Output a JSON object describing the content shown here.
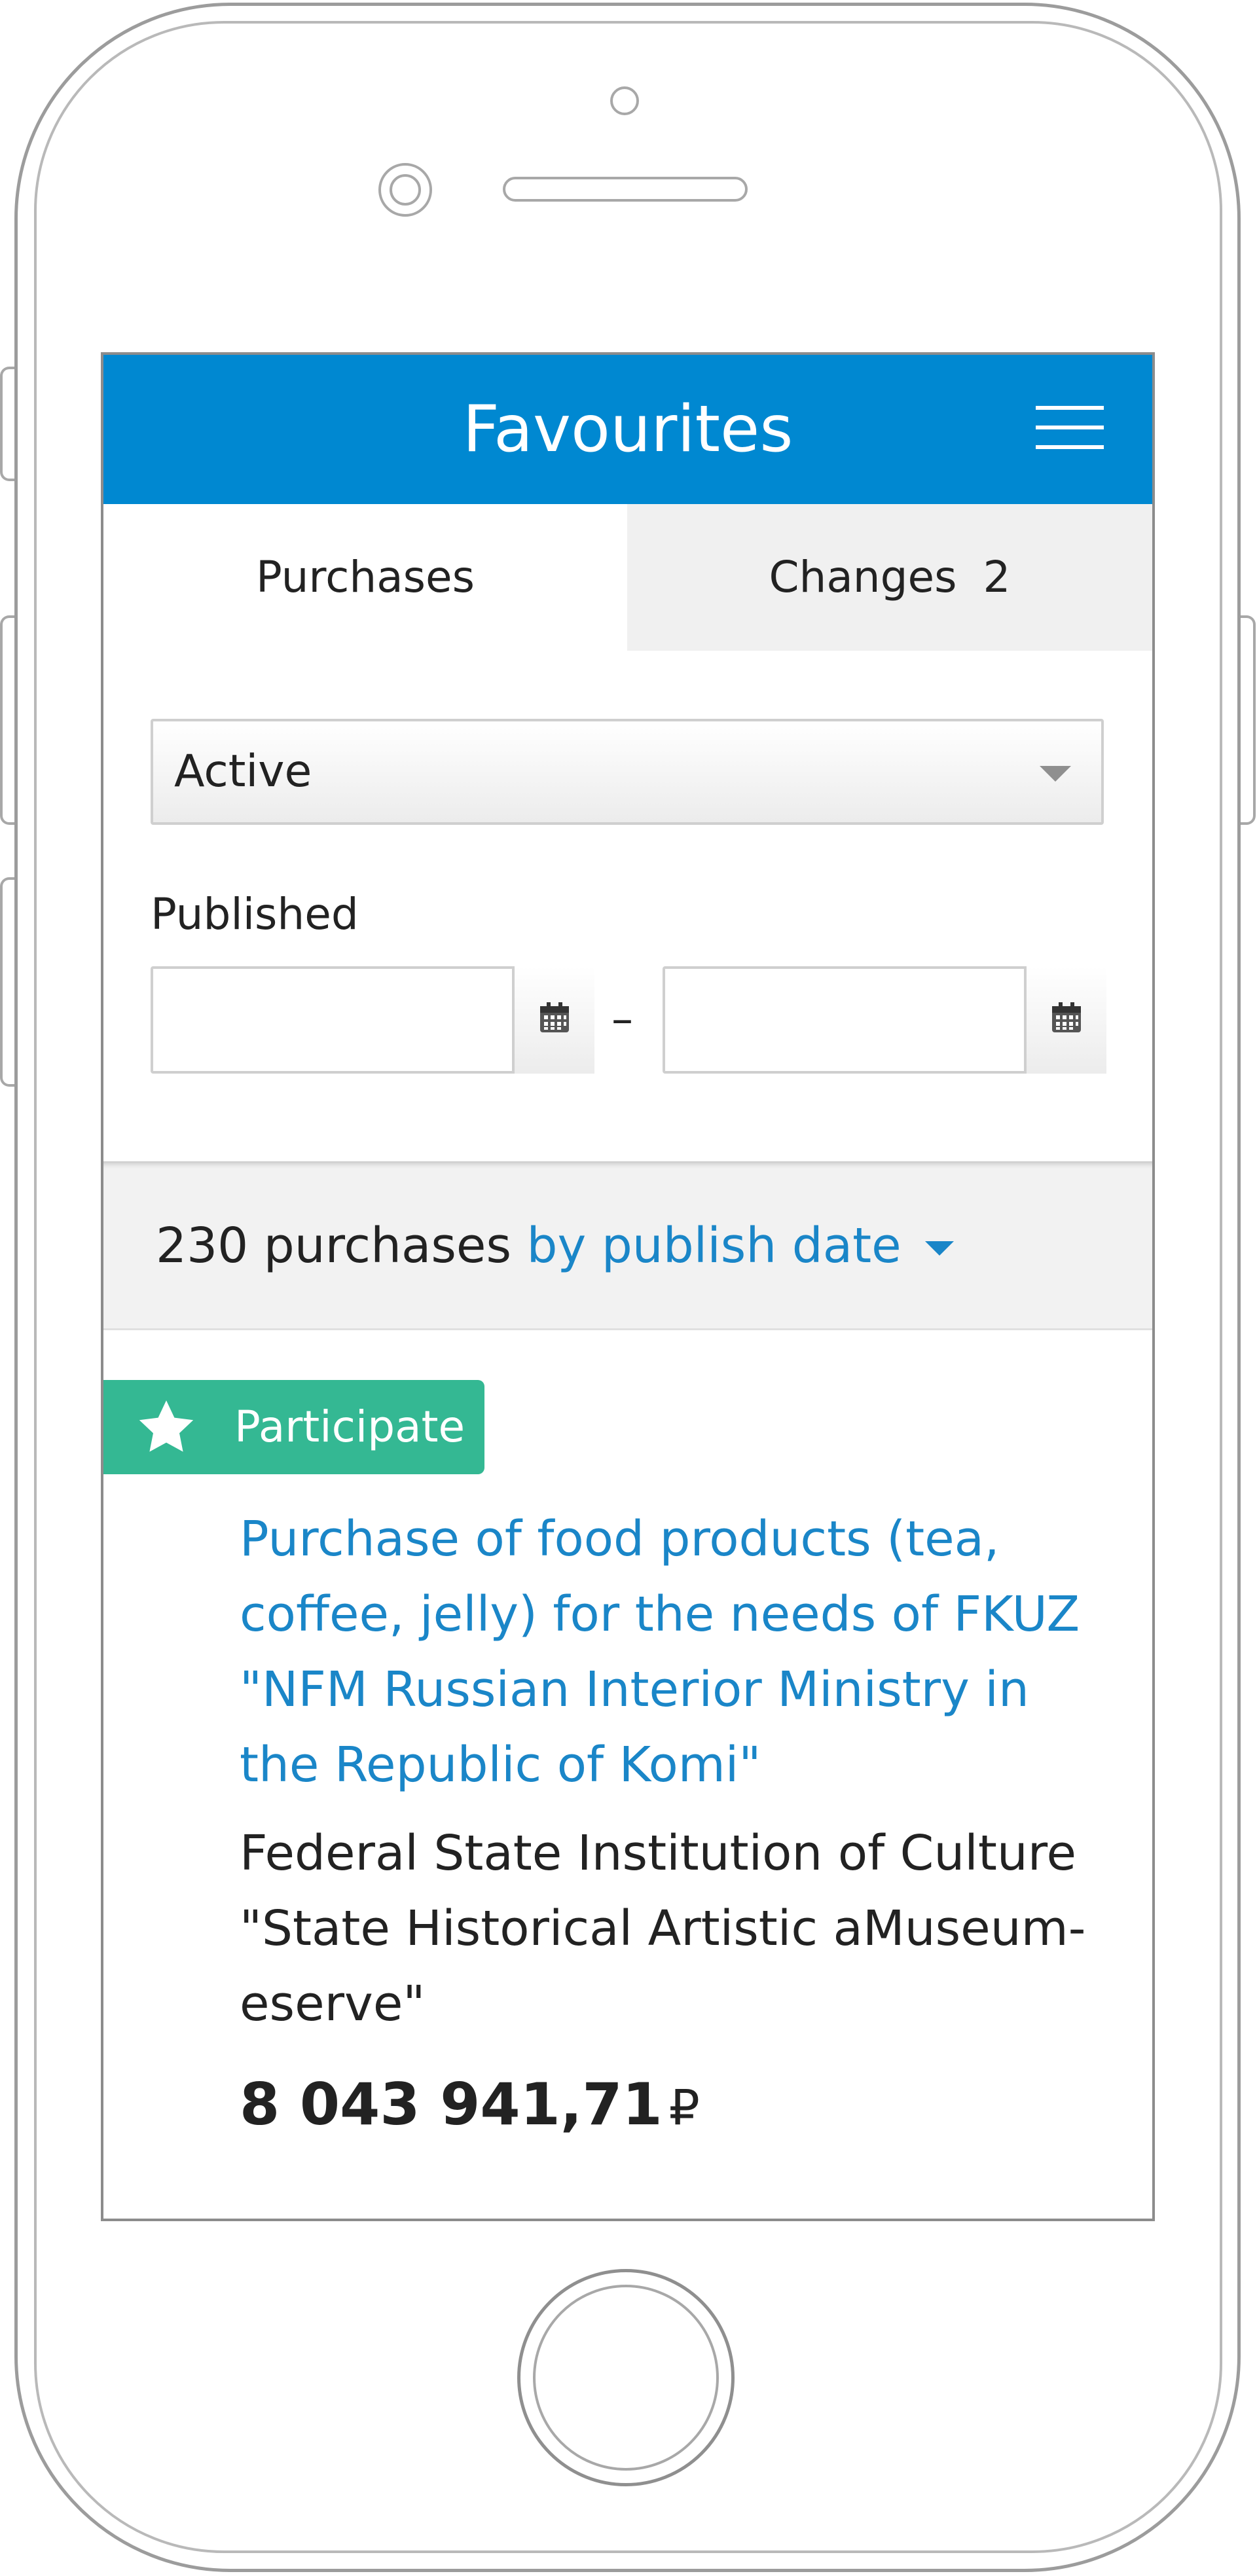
{
  "header": {
    "title": "Favourites",
    "menu_icon": "hamburger-menu-icon"
  },
  "tabs": [
    {
      "label": "Purchases",
      "active": true
    },
    {
      "label": "Changes",
      "count": "2",
      "active": false
    }
  ],
  "filters": {
    "status": {
      "value": "Active"
    },
    "published": {
      "label": "Published",
      "from_value": "",
      "to_value": "",
      "separator": "–"
    }
  },
  "results": {
    "count_text": "230 purchases",
    "sort_label": "by publish date"
  },
  "purchase": {
    "badge_label": "Participate",
    "title": "Purchase of food products (tea, coffee, jelly) for the needs of FKUZ \"NFM Russian Interior Ministry in the Republic of Komi\"",
    "organization": "Federal State Institution of Culture \"State Historical Artistic aMuseum-eserve\"",
    "price": "8 043 941,71",
    "currency": "₽"
  },
  "colors": {
    "header_bg": "#0088d1",
    "link": "#1a86c8",
    "badge_bg": "#34b893",
    "inactive_tab_bg": "#f0f0f0"
  }
}
